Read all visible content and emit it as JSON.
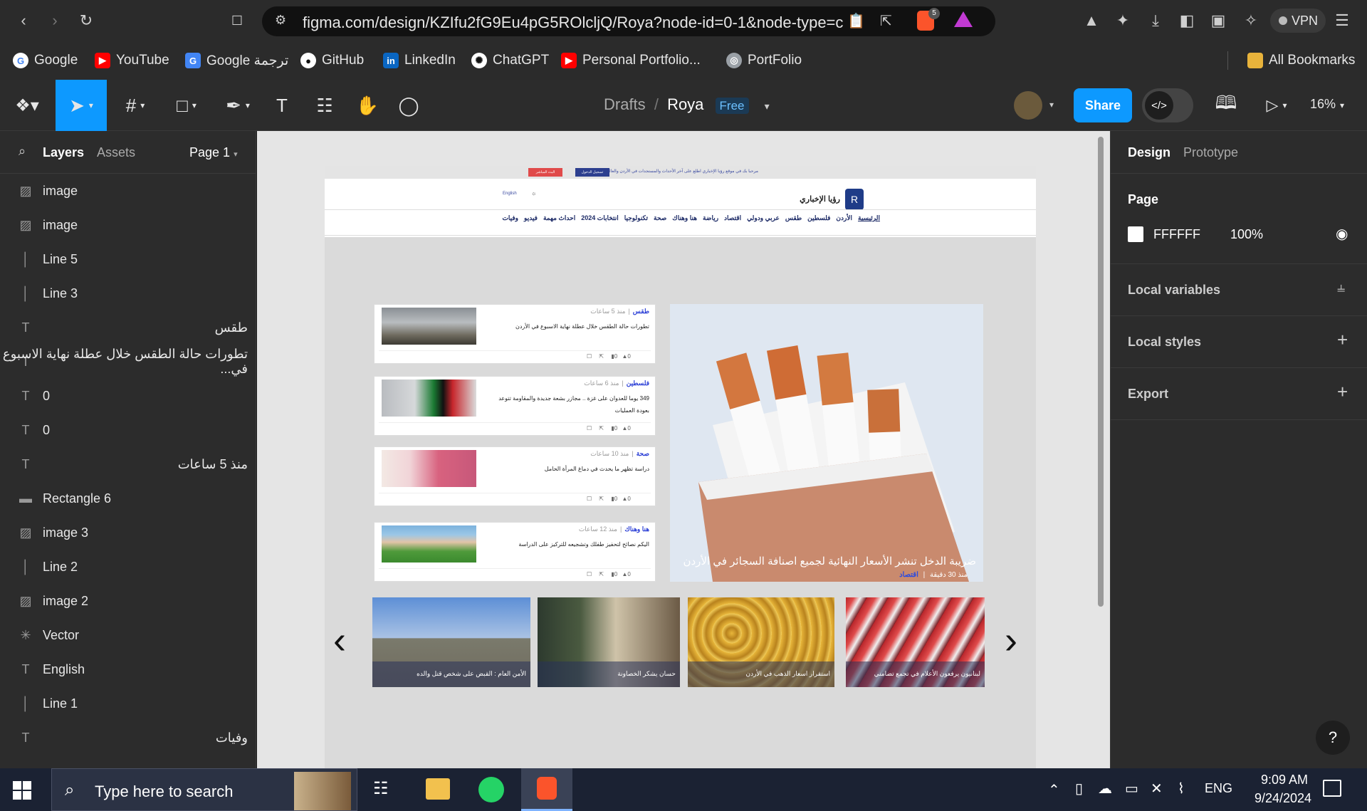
{
  "browser": {
    "url": "figma.com/design/KZIfu2fG9Eu4pG5ROlcljQ/Roya?node-id=0-1&node-type=c...",
    "brave_badge": "5",
    "vpn_label": "VPN",
    "bookmarks": [
      {
        "label": "Google",
        "icon": "google-icon",
        "color": "#4285f4"
      },
      {
        "label": "YouTube",
        "icon": "youtube-icon",
        "color": "#ff0000"
      },
      {
        "label": "Google ترجمة",
        "icon": "translate-icon",
        "color": "#4285f4"
      },
      {
        "label": "GitHub",
        "icon": "github-icon",
        "color": "#ffffff"
      },
      {
        "label": "LinkedIn",
        "icon": "linkedin-icon",
        "color": "#0a66c2"
      },
      {
        "label": "ChatGPT",
        "icon": "chatgpt-icon",
        "color": "#ffffff"
      },
      {
        "label": "Personal Portfolio...",
        "icon": "youtube-icon",
        "color": "#ff0000"
      },
      {
        "label": "PortFolio",
        "icon": "globe-icon",
        "color": "#9aa0a6"
      }
    ],
    "all_bookmarks": "All Bookmarks"
  },
  "figma": {
    "breadcrumb_drafts": "Drafts",
    "breadcrumb_sep": "/",
    "file_name": "Roya",
    "plan_badge": "Free",
    "share_label": "Share",
    "zoom": "16%",
    "accent": "#0d99ff"
  },
  "left_panel": {
    "tab_layers": "Layers",
    "tab_assets": "Assets",
    "page_selector": "Page 1",
    "layers": [
      {
        "icon": "image-icon",
        "name": "image",
        "rtl": false
      },
      {
        "icon": "image-icon",
        "name": "image",
        "rtl": false
      },
      {
        "icon": "line-icon",
        "name": "Line 5",
        "rtl": false
      },
      {
        "icon": "line-icon",
        "name": "Line 3",
        "rtl": false
      },
      {
        "icon": "text-icon",
        "name": "طقس",
        "rtl": true
      },
      {
        "icon": "text-icon",
        "name": "تطورات حالة الطقس خلال عطلة نهاية الاسبوع في...",
        "rtl": true
      },
      {
        "icon": "text-icon",
        "name": "0",
        "rtl": false
      },
      {
        "icon": "text-icon",
        "name": "0",
        "rtl": false
      },
      {
        "icon": "text-icon",
        "name": "منذ 5 ساعات",
        "rtl": true
      },
      {
        "icon": "rectangle-icon",
        "name": "Rectangle 6",
        "rtl": false
      },
      {
        "icon": "image-icon",
        "name": "image 3",
        "rtl": false
      },
      {
        "icon": "line-icon",
        "name": "Line 2",
        "rtl": false
      },
      {
        "icon": "image-icon",
        "name": "image 2",
        "rtl": false
      },
      {
        "icon": "vector-icon",
        "name": "Vector",
        "rtl": false
      },
      {
        "icon": "text-icon",
        "name": "English",
        "rtl": false
      },
      {
        "icon": "line-icon",
        "name": "Line 1",
        "rtl": false
      },
      {
        "icon": "text-icon",
        "name": "وفيات",
        "rtl": true
      }
    ]
  },
  "right_panel": {
    "tab_design": "Design",
    "tab_prototype": "Prototype",
    "page_title": "Page",
    "page_color": "FFFFFF",
    "page_opacity": "100%",
    "local_variables": "Local variables",
    "local_styles": "Local styles",
    "export": "Export",
    "help": "?"
  },
  "design": {
    "top_strip_text": "مرحبا بك في موقع رؤيا الإخباري اطلع على آخر الأحداث والمستجدات في الأردن والعالم",
    "btn_red": "البث المباشر",
    "btn_blue": "تسجيل الدخول",
    "lang": "English",
    "logo_text": "رؤيا الإخباري",
    "nav": [
      "الرئيسية",
      "الأردن",
      "فلسطين",
      "طقس",
      "عربي ودولي",
      "اقتصاد",
      "رياضة",
      "هنا وهناك",
      "صحة",
      "تكنولوجيا",
      "انتخابات 2024",
      "احداث مهمة",
      "فيديو",
      "وفيات"
    ],
    "hero_title": "ضريبة الدخل تنشر الأسعار النهائية لجميع اصنافة السجائر في الأردن",
    "hero_time": "منذ 30 دقيقة",
    "hero_cat": "اقتصاد",
    "cards": [
      {
        "time": "منذ 5 ساعات",
        "cat": "طقس",
        "title": "تطورات حالة الطقس خلال عطلة نهاية الاسبوع في الأردن",
        "likes": "0",
        "comments": "0"
      },
      {
        "time": "منذ 6 ساعات",
        "cat": "فلسطين",
        "title": "349 يوما للعدوان على غزة .. مجازر بشعة جديدة والمقاومة تتوعد بعودة العمليات",
        "likes": "0",
        "comments": "0"
      },
      {
        "time": "منذ 10 ساعات",
        "cat": "صحة",
        "title": "دراسة تظهر ما يحدث في دماغ المرأة الحامل",
        "likes": "0",
        "comments": "0"
      },
      {
        "time": "منذ 12 ساعات",
        "cat": "هنا وهناك",
        "title": "اليكم نصائح لتحفيز طفلك وتشجيعه للتركيز على الدراسة",
        "likes": "0",
        "comments": "0"
      }
    ],
    "slides": [
      {
        "caption": "الأمن العام : القبض على شخص قتل والده"
      },
      {
        "caption": "حسان يشكر الخصاونة"
      },
      {
        "caption": "استقرار اسعار الذهب في الأردن"
      },
      {
        "caption": "لبنانيون يرفعون الأعلام في تجمع تضامني"
      }
    ]
  },
  "taskbar": {
    "search_placeholder": "Type here to search",
    "lang": "ENG",
    "time": "9:09 AM",
    "date": "9/24/2024"
  }
}
